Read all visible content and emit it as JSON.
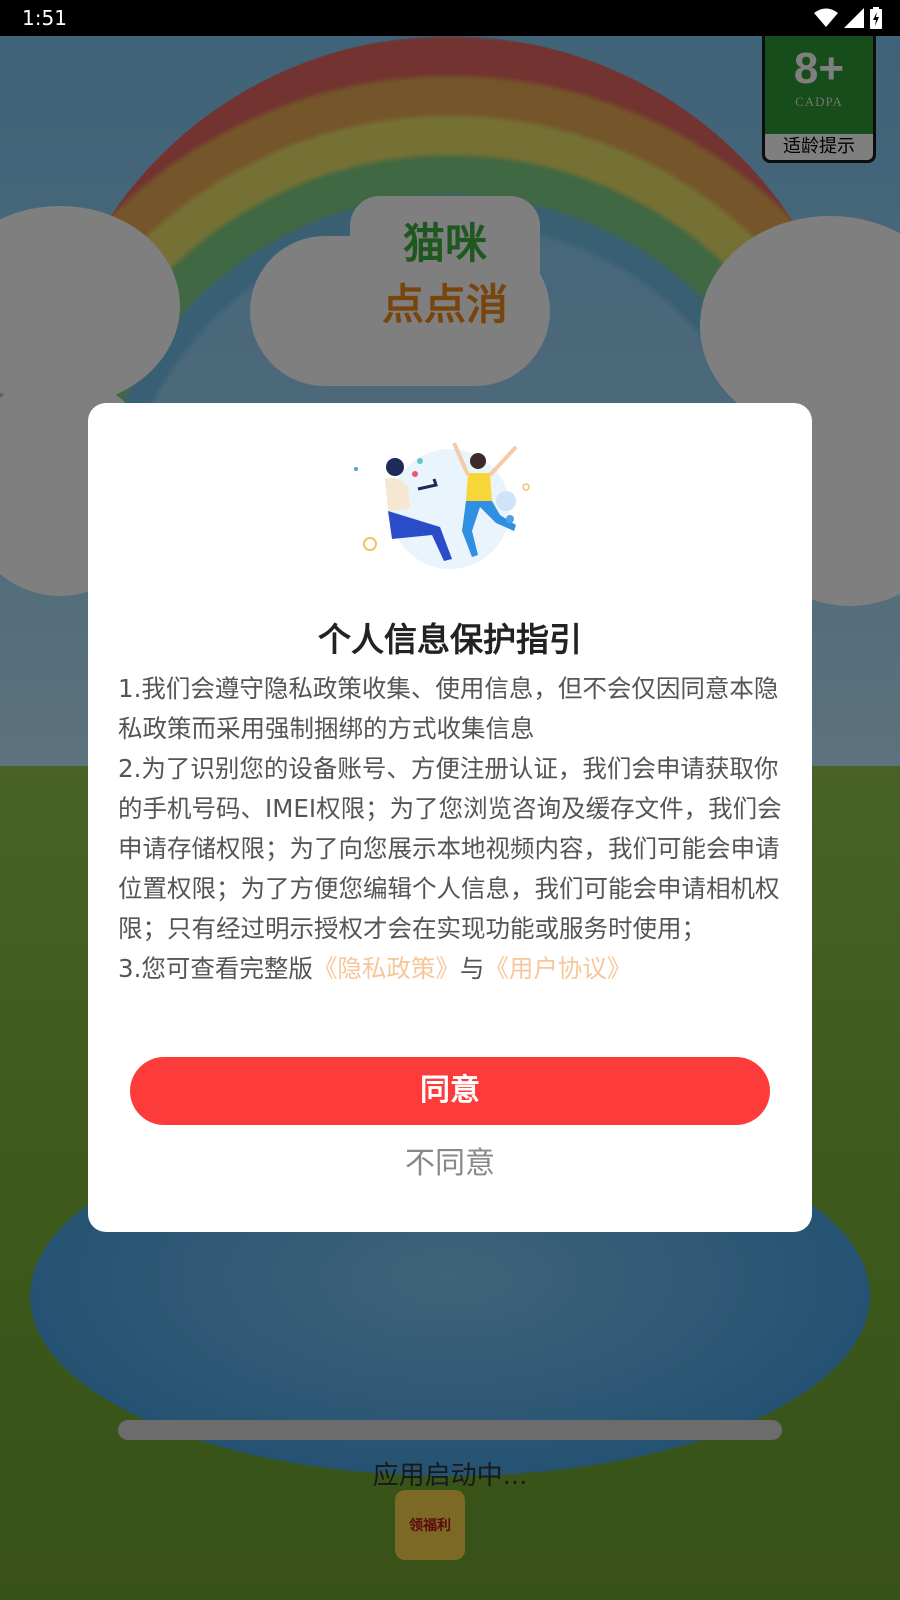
{
  "status_bar": {
    "time": "1:51"
  },
  "age_badge": {
    "rating": "8+",
    "org": "CADPA",
    "label": "适龄提示"
  },
  "game_logo": {
    "line1": "猫咪",
    "line2": "点点消"
  },
  "dialog": {
    "title": "个人信息保护指引",
    "para1": "1.我们会遵守隐私政策收集、使用信息，但不会仅因同意本隐私政策而采用强制捆绑的方式收集信息",
    "para2": "2.为了识别您的设备账号、方便注册认证，我们会申请获取你的手机号码、IMEI权限；为了您浏览咨询及缓存文件，我们会申请存储权限；为了向您展示本地视频内容，我们可能会申请位置权限；为了方便您编辑个人信息，我们可能会申请相机权限；只有经过明示授权才会在实现功能或服务时使用；",
    "para3_prefix": "3.您可查看完整版",
    "privacy_link": "《隐私政策》",
    "and_text": "与",
    "user_agreement_link": "《用户协议》",
    "agree_label": "同意",
    "disagree_label": "不同意"
  },
  "loading": {
    "text": "应用启动中...",
    "small_logo_text": "领福利"
  },
  "colors": {
    "agree_button": "#fe3b3b",
    "link": "#f6c79a",
    "title": "#222222"
  }
}
